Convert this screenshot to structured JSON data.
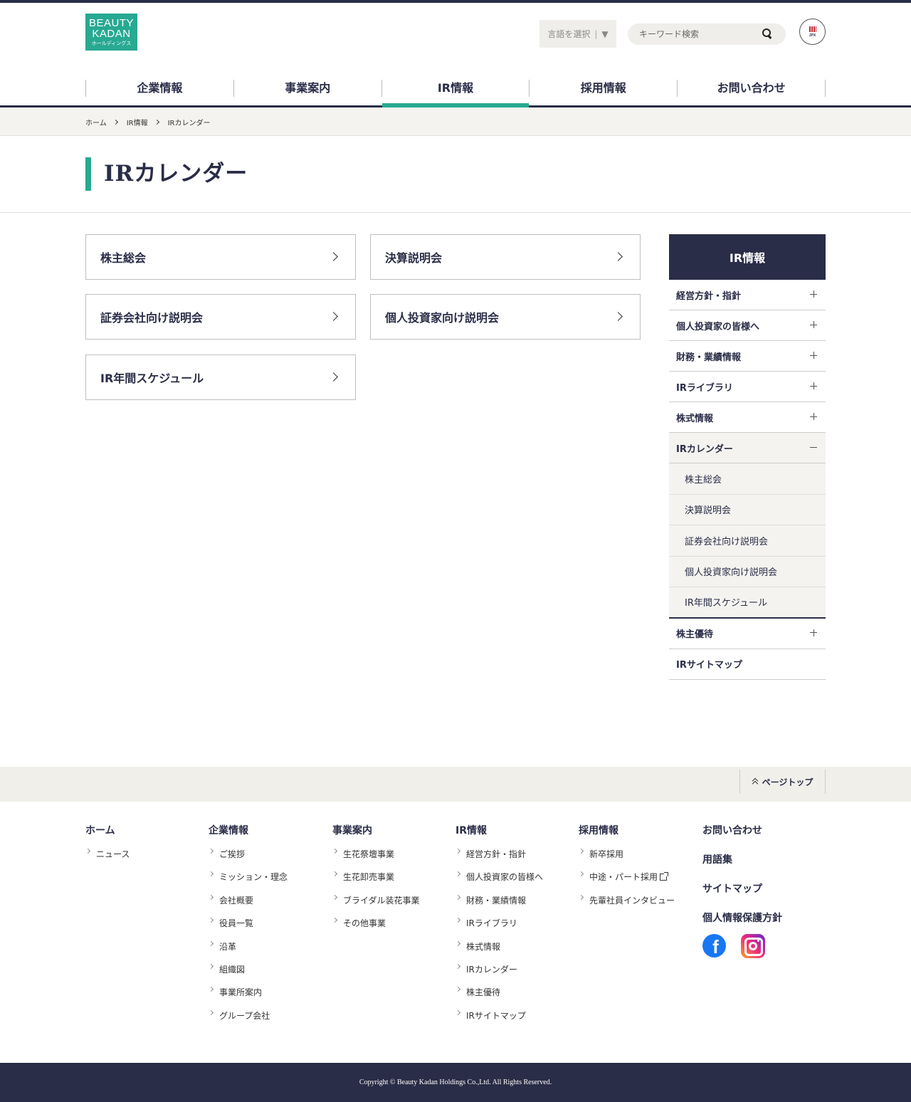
{
  "logo": {
    "line1": "BEAUTY",
    "line2": "KADAN",
    "line3": "ホールディングス"
  },
  "header": {
    "language_label": "言語を選択",
    "language_arrow": "▼",
    "search_placeholder": "キーワード検索",
    "jpx_text": "JPX"
  },
  "gnav": [
    "企業情報",
    "事業案内",
    "IR情報",
    "採用情報",
    "お問い合わせ"
  ],
  "breadcrumb": [
    "ホーム",
    "IR情報",
    "IRカレンダー"
  ],
  "page_title": "IRカレンダー",
  "cards": [
    "株主総会",
    "決算説明会",
    "証券会社向け説明会",
    "個人投資家向け説明会",
    "IR年間スケジュール"
  ],
  "sidebar": {
    "heading": "IR情報",
    "items": [
      "経営方針・指針",
      "個人投資家の皆様へ",
      "財務・業績情報",
      "IRライブラリ",
      "株式情報",
      "IRカレンダー"
    ],
    "subitems": [
      "株主総会",
      "決算説明会",
      "証券会社向け説明会",
      "個人投資家向け説明会",
      "IR年間スケジュール"
    ],
    "after": [
      "株主優待",
      "IRサイトマップ"
    ]
  },
  "pagetop": "ページトップ",
  "footer": {
    "col1": {
      "title": "ホーム",
      "links": [
        "ニュース"
      ]
    },
    "col2": {
      "title": "企業情報",
      "links": [
        "ご挨拶",
        "ミッション・理念",
        "会社概要",
        "役員一覧",
        "沿革",
        "組織図",
        "事業所案内",
        "グループ会社"
      ]
    },
    "col3": {
      "title": "事業案内",
      "links": [
        "生花祭壇事業",
        "生花卸売事業",
        "ブライダル装花事業",
        "その他事業"
      ]
    },
    "col4": {
      "title": "IR情報",
      "links": [
        "経営方針・指針",
        "個人投資家の皆様へ",
        "財務・業績情報",
        "IRライブラリ",
        "株式情報",
        "IRカレンダー",
        "株主優待",
        "IRサイトマップ"
      ]
    },
    "col5": {
      "title": "採用情報",
      "links": [
        "新卒採用",
        "中途・パート採用",
        "先輩社員インタビュー"
      ]
    },
    "col6": [
      "お問い合わせ",
      "用語集",
      "サイトマップ",
      "個人情報保護方針"
    ],
    "facebook_glyph": "f"
  },
  "copyright": "Copyright © Beauty Kadan Holdings Co.,Ltd. All Rights Reserved.",
  "colors": {
    "navy": "#2a2d47",
    "accent": "#27a992",
    "band": "#f4f3ef"
  }
}
